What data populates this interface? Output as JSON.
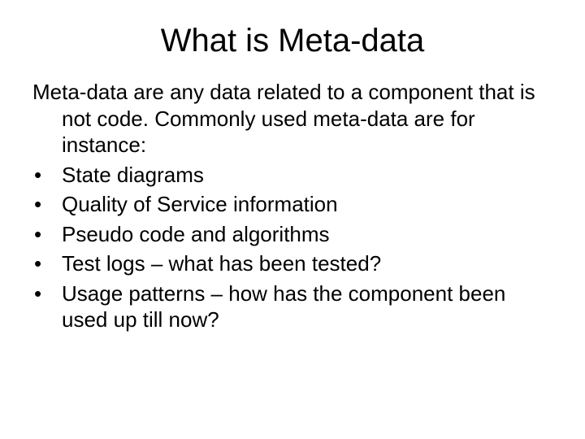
{
  "title": "What is Meta-data",
  "intro": "Meta-data are any data related to a component that is not code. Commonly used meta-data are for instance:",
  "bullets": [
    "State diagrams",
    "Quality of Service information",
    "Pseudo code and algorithms",
    "Test logs – what has been tested?",
    "Usage patterns – how has the component been used up till now?"
  ]
}
